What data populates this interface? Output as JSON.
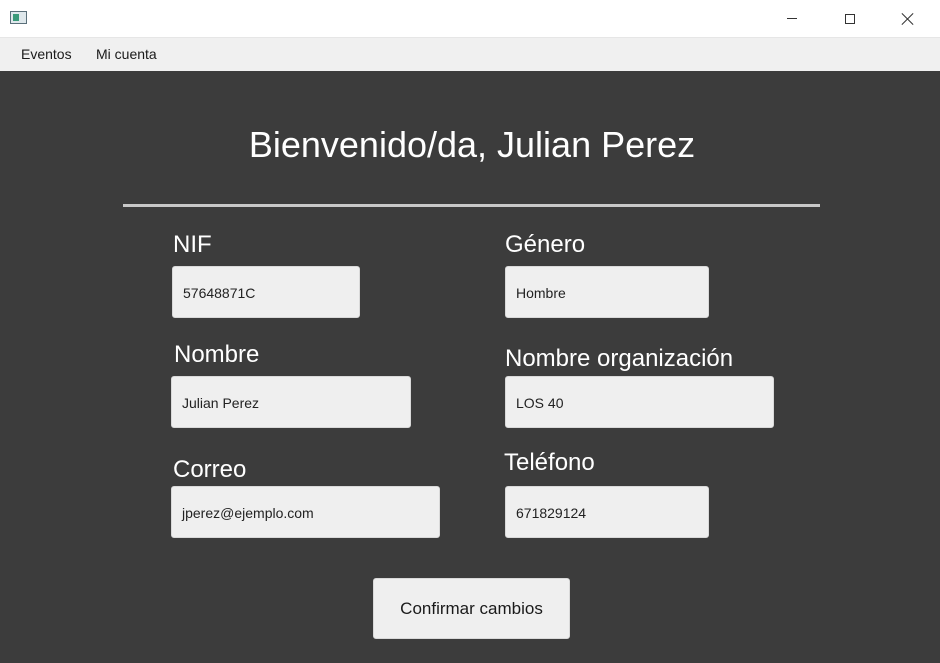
{
  "window": {
    "min_icon": "minimize-icon",
    "max_icon": "maximize-icon",
    "close_icon": "close-icon"
  },
  "menu": {
    "items": [
      {
        "label": "Eventos"
      },
      {
        "label": "Mi cuenta"
      }
    ]
  },
  "main": {
    "welcome": "Bienvenido/da, Julian Perez",
    "fields": {
      "nif": {
        "label": "NIF",
        "value": "57648871C"
      },
      "genero": {
        "label": "Género",
        "value": "Hombre"
      },
      "nombre": {
        "label": "Nombre",
        "value": "Julian Perez"
      },
      "organizacion": {
        "label": "Nombre organización",
        "value": "LOS 40"
      },
      "correo": {
        "label": "Correo",
        "value": "jperez@ejemplo.com"
      },
      "telefono": {
        "label": "Teléfono",
        "value": "671829124"
      }
    },
    "confirm_label": "Confirmar cambios"
  },
  "colors": {
    "background": "#3c3c3c",
    "field": "#efefef",
    "divider": "#c8c8c8",
    "text_light": "#ffffff"
  }
}
